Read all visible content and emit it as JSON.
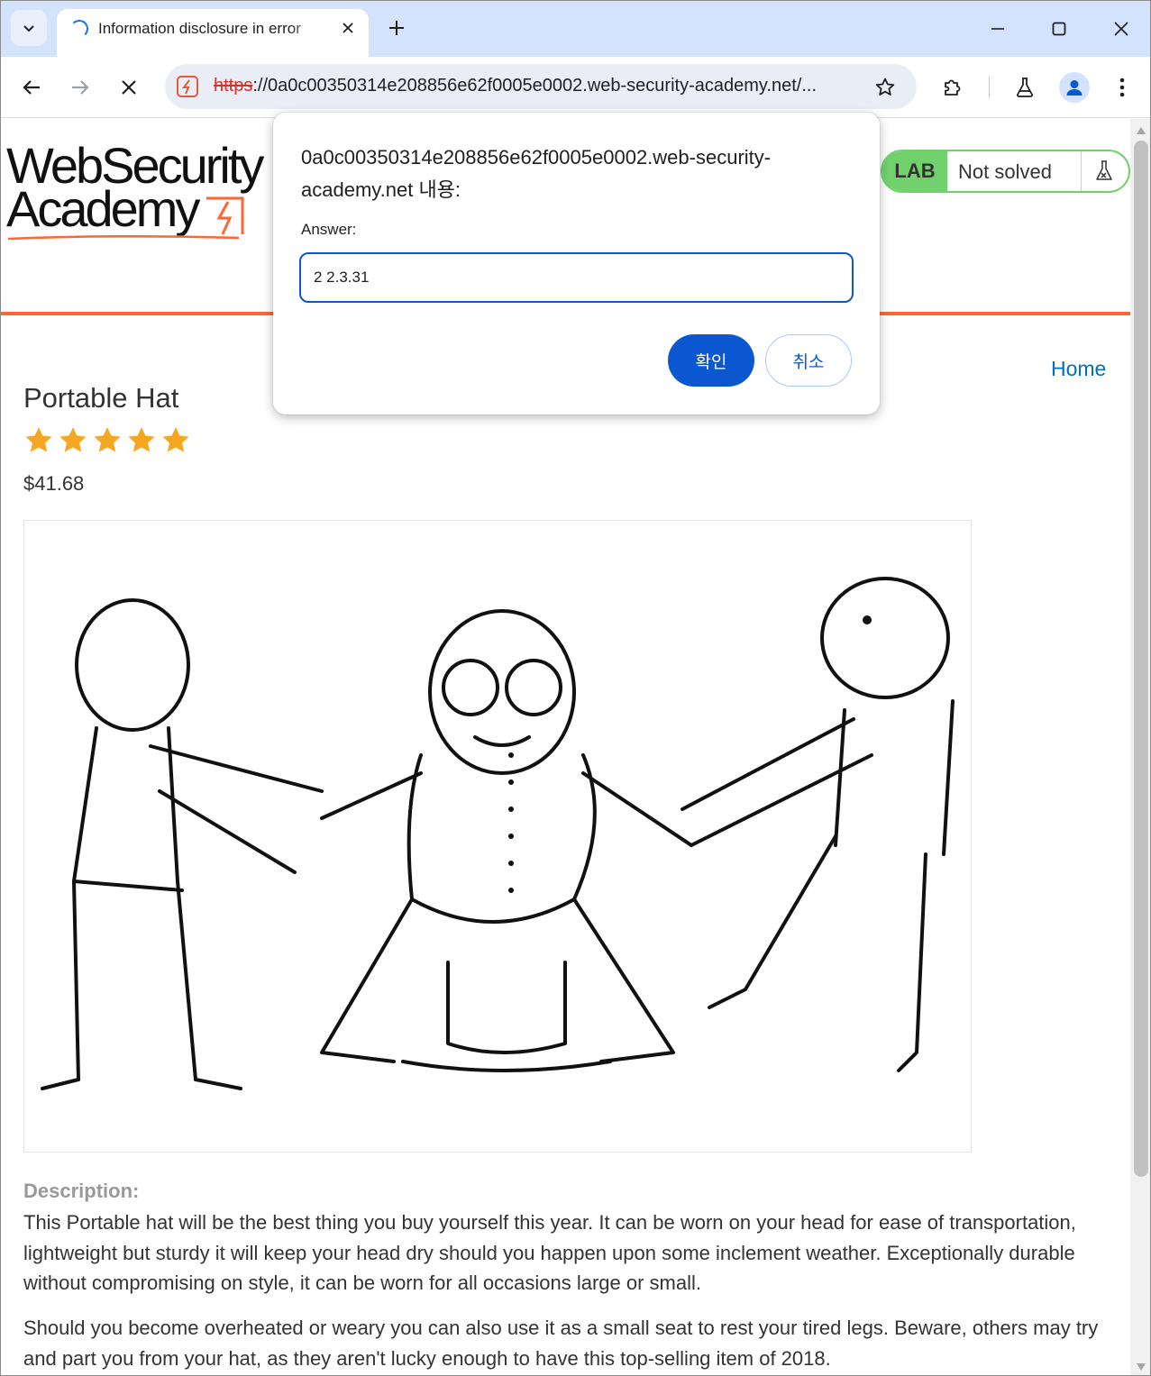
{
  "browser": {
    "tab_title": "Information disclosure in error",
    "url_scheme": "https",
    "url_rest": "://0a0c00350314e208856e62f0005e0002.web-security-academy.net/..."
  },
  "header": {
    "logo_line1": "WebSecurity",
    "logo_line2": "Academy",
    "lab_badge": "LAB",
    "lab_status": "Not solved"
  },
  "nav": {
    "home": "Home"
  },
  "product": {
    "title": "Portable Hat",
    "rating_stars": 5,
    "price": "$41.68",
    "description_label": "Description:",
    "description_p1": "This Portable hat will be the best thing you buy yourself this year. It can be worn on your head for ease of transportation, lightweight but sturdy it will keep your head dry should you happen upon some inclement weather. Exceptionally durable without compromising on style, it can be worn for all occasions large or small.",
    "description_p2": "Should you become overheated or weary you can also use it as a small seat to rest your tired legs. Beware, others may try and part you from your hat, as they aren't lucky enough to have this top-selling item of 2018."
  },
  "dialog": {
    "message": "0a0c00350314e208856e62f0005e0002.web-security-academy.net 내용:",
    "label": "Answer:",
    "input_value": "2 2.3.31",
    "ok_label": "확인",
    "cancel_label": "취소"
  },
  "colors": {
    "accent_orange": "#ff6633",
    "lab_green": "#70d16d",
    "link_blue": "#0071bc",
    "dialog_blue": "#0b57d0",
    "star_gold": "#f5a623"
  }
}
